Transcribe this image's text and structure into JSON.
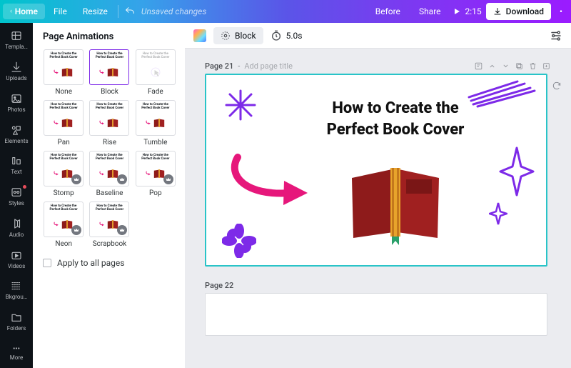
{
  "topbar": {
    "home": "Home",
    "file": "File",
    "resize": "Resize",
    "unsaved": "Unsaved changes",
    "before": "Before",
    "share": "Share",
    "play_time": "2:15",
    "download": "Download"
  },
  "rail": {
    "items": [
      "Templa…",
      "Uploads",
      "Photos",
      "Elements",
      "Text",
      "Styles",
      "Audio",
      "Videos",
      "Bkgrou…",
      "Folders",
      "More"
    ]
  },
  "panel": {
    "title": "Page Animations",
    "animations": [
      {
        "label": "None",
        "premium": false,
        "sel": false,
        "fade": false
      },
      {
        "label": "Block",
        "premium": false,
        "sel": true,
        "fade": false
      },
      {
        "label": "Fade",
        "premium": false,
        "sel": false,
        "fade": true
      },
      {
        "label": "Pan",
        "premium": false,
        "sel": false,
        "fade": false
      },
      {
        "label": "Rise",
        "premium": false,
        "sel": false,
        "fade": false
      },
      {
        "label": "Tumble",
        "premium": false,
        "sel": false,
        "fade": false
      },
      {
        "label": "Stomp",
        "premium": true,
        "sel": false,
        "fade": false
      },
      {
        "label": "Baseline",
        "premium": true,
        "sel": false,
        "fade": false
      },
      {
        "label": "Pop",
        "premium": true,
        "sel": false,
        "fade": false
      },
      {
        "label": "Neon",
        "premium": true,
        "sel": false,
        "fade": false
      },
      {
        "label": "Scrapbook",
        "premium": true,
        "sel": false,
        "fade": false
      }
    ],
    "thumb_text": "How to Create the Perfect Book Cover",
    "apply_all": "Apply to all pages"
  },
  "toolbar": {
    "effect": "Block",
    "duration": "5.0s"
  },
  "pages": {
    "current_num": "Page 21",
    "title_placeholder": "Add page title",
    "next_num": "Page 22",
    "slide_title_l1": "How to Create the",
    "slide_title_l2": "Perfect Book Cover"
  }
}
